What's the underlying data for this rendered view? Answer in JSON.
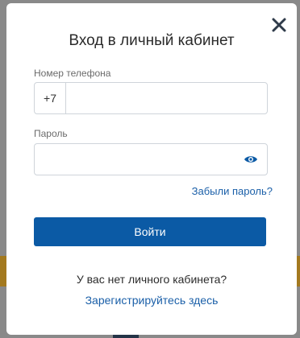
{
  "modal": {
    "title": "Вход в личный кабинет",
    "close_icon": "close-icon",
    "phone": {
      "label": "Номер телефона",
      "prefix": "+7",
      "value": "",
      "placeholder": ""
    },
    "password": {
      "label": "Пароль",
      "value": "",
      "placeholder": "",
      "toggle_icon": "eye-icon"
    },
    "forgot_link": "Забыли пароль?",
    "submit_label": "Войти",
    "no_account_text": "У вас нет личного кабинета?",
    "register_link": "Зарегистрируйтесь здесь"
  },
  "colors": {
    "accent": "#0b5aa5",
    "link": "#1a5fa8",
    "overlay": "#898989",
    "background_band": "#a3791f"
  }
}
